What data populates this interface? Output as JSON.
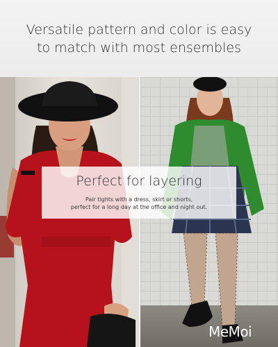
{
  "header": {
    "headline": "Versatile pattern and color is easy\nto match with most ensembles"
  },
  "overlay": {
    "title": "Perfect for layering",
    "text": "Pair tights with a dress, skirt or shorts,\nperfect for a long day at the office and night out."
  },
  "brand": {
    "logo": "MeMoi"
  },
  "colors": {
    "red_dress": "#b5121b",
    "green_jacket": "#2e8b2e",
    "sage_top": "#7a9e76",
    "plaid_skirt": "#2c3550"
  }
}
